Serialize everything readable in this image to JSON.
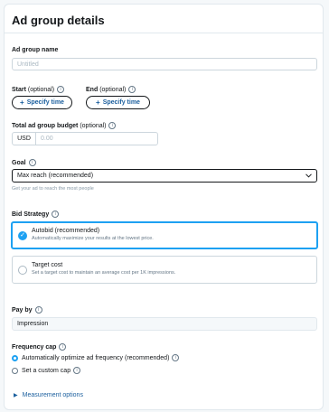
{
  "header": {
    "title": "Ad group details"
  },
  "ad_group_name": {
    "label": "Ad group name",
    "placeholder": "Untitled"
  },
  "start": {
    "label": "Start",
    "optional": "(optional)",
    "button": "Specify time"
  },
  "end": {
    "label": "End",
    "optional": "(optional)",
    "button": "Specify time"
  },
  "budget": {
    "label": "Total ad group budget",
    "optional": "(optional)",
    "currency": "USD",
    "placeholder": "0.00"
  },
  "goal": {
    "label": "Goal",
    "selected": "Max reach (recommended)",
    "help": "Get your ad to reach the most people"
  },
  "bid_strategy": {
    "label": "Bid Strategy",
    "options": [
      {
        "title": "Autobid (recommended)",
        "desc": "Automatically maximize your results at the lowest price.",
        "selected": true
      },
      {
        "title": "Target cost",
        "desc": "Set a target cost to maintain an average cost per 1K impressions.",
        "selected": false
      }
    ]
  },
  "pay_by": {
    "label": "Pay by",
    "value": "Impression"
  },
  "frequency_cap": {
    "label": "Frequency cap",
    "options": [
      {
        "label": "Automatically optimize ad frequency (recommended)",
        "selected": true
      },
      {
        "label": "Set a custom cap",
        "selected": false
      }
    ]
  },
  "measurement": {
    "label": "Measurement options"
  },
  "colors": {
    "accent": "#1da1f2",
    "link": "#1b5f9e",
    "border": "#ccd6dd"
  }
}
